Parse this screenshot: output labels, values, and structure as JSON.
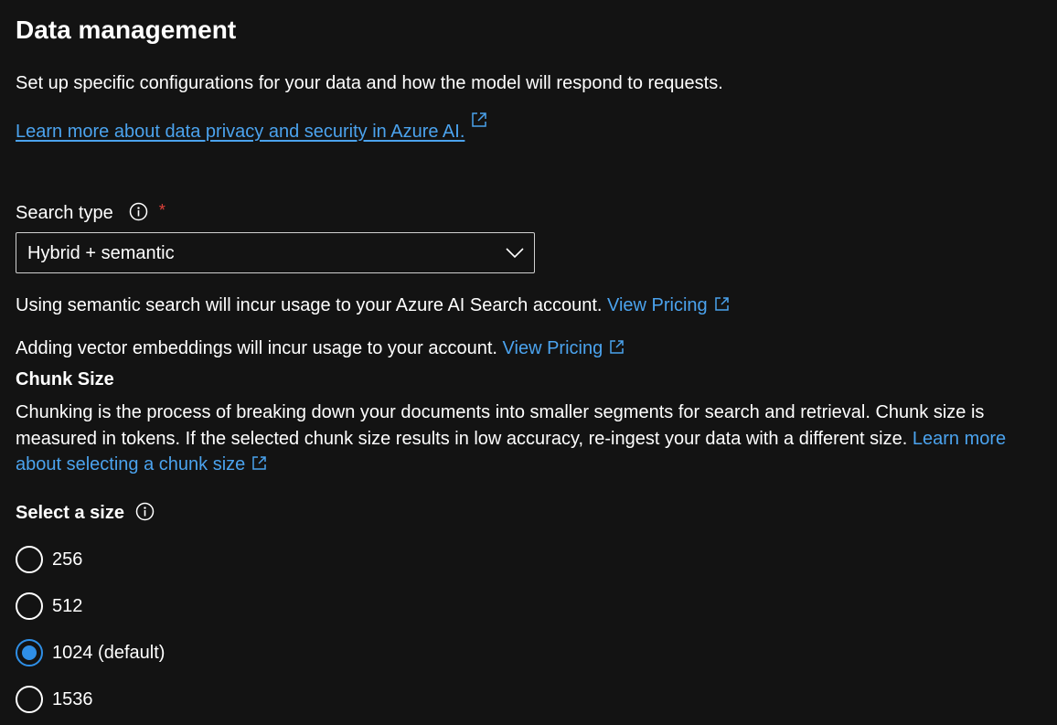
{
  "title": "Data management",
  "intro": "Set up specific configurations for your data and how the model will respond to requests.",
  "privacy_link": "Learn more about data privacy and security in Azure AI.",
  "search_type": {
    "label": "Search type",
    "required_mark": "*",
    "selected": "Hybrid + semantic"
  },
  "notices": [
    {
      "text": "Using semantic search will incur usage to your Azure AI Search account.",
      "link": "View Pricing"
    },
    {
      "text": "Adding vector embeddings will incur usage to your account.",
      "link": "View Pricing"
    }
  ],
  "chunk_size": {
    "heading": "Chunk Size",
    "description": "Chunking is the process of breaking down your documents into smaller segments for search and retrieval. Chunk size is measured in tokens. If the selected chunk size results in low accuracy, re-ingest your data with a different size.",
    "learn_more": "Learn more about selecting a chunk size",
    "select_label": "Select a size",
    "options": [
      {
        "label": "256",
        "checked": false
      },
      {
        "label": "512",
        "checked": false
      },
      {
        "label": "1024 (default)",
        "checked": true
      },
      {
        "label": "1536",
        "checked": false
      }
    ]
  },
  "colors": {
    "background": "#131313",
    "text": "#ffffff",
    "link": "#4ba3ee",
    "accent": "#2f8fe6",
    "required": "#e0413b"
  },
  "icons": [
    "info-icon",
    "external-link-icon",
    "chevron-down-icon"
  ]
}
